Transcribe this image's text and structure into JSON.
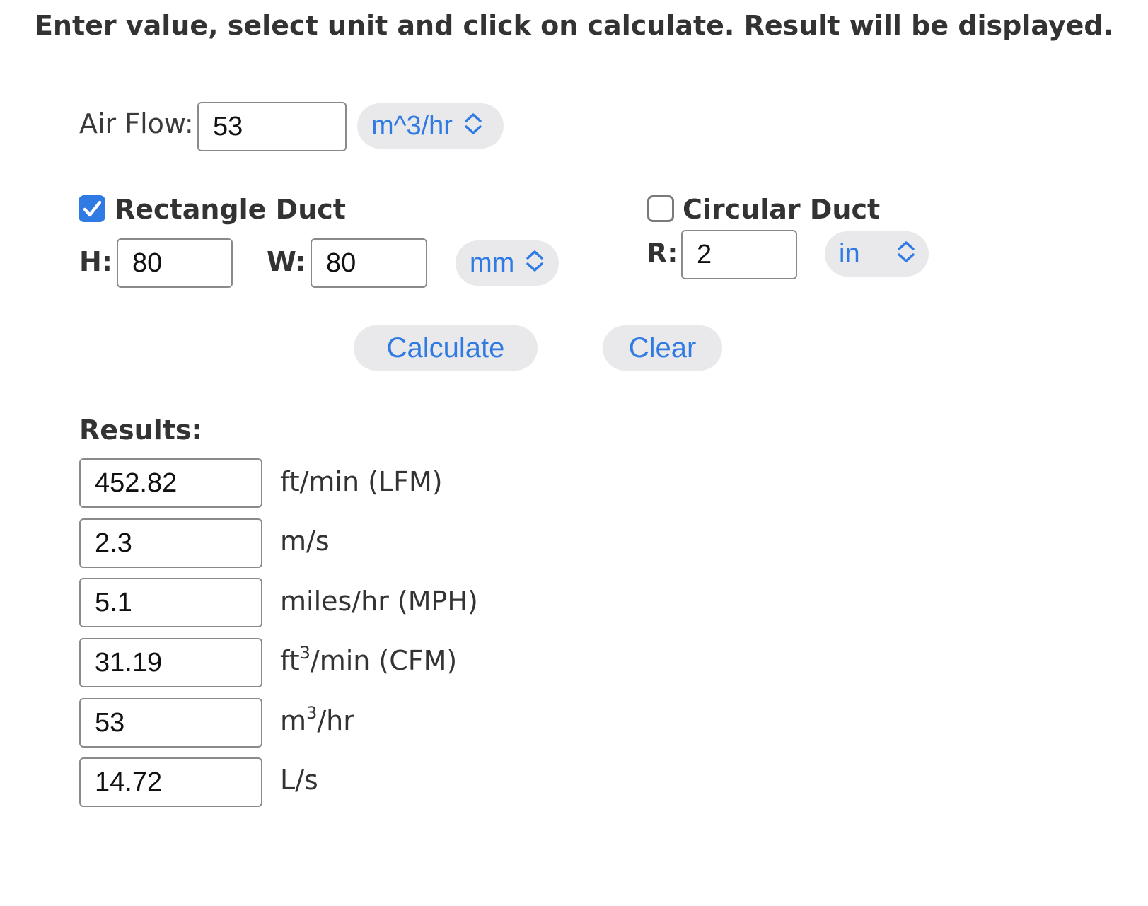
{
  "instructions": "Enter value, select unit and click on calculate. Result will be displayed.",
  "air_flow": {
    "label": "Air Flow:",
    "value": "53",
    "unit": "m^3/hr"
  },
  "rect_duct": {
    "checked": true,
    "label": "Rectangle Duct",
    "h_label": "H:",
    "h_value": "80",
    "w_label": "W:",
    "w_value": "80",
    "unit": "mm"
  },
  "circ_duct": {
    "checked": false,
    "label": "Circular Duct",
    "r_label": "R:",
    "r_value": "2",
    "unit": "in"
  },
  "buttons": {
    "calculate": "Calculate",
    "clear": "Clear"
  },
  "results": {
    "title": "Results:",
    "rows": [
      {
        "value": "452.82",
        "unit": "ft/min (LFM)"
      },
      {
        "value": "2.3",
        "unit": "m/s"
      },
      {
        "value": "5.1",
        "unit": "miles/hr (MPH)"
      },
      {
        "value": "31.19",
        "unit_pre": "ft",
        "unit_sup": "3",
        "unit_post": "/min (CFM)"
      },
      {
        "value": "53",
        "unit_pre": "m",
        "unit_sup": "3",
        "unit_post": "/hr"
      },
      {
        "value": "14.72",
        "unit": "L/s"
      }
    ]
  },
  "colors": {
    "accent": "#2f7be3",
    "pill_bg": "#e9e9eb",
    "input_border": "#8a8a8a",
    "text": "#333333"
  },
  "icons": {
    "select_chevron": "chevron-up-down-icon",
    "checkmark": "checkmark-icon"
  }
}
